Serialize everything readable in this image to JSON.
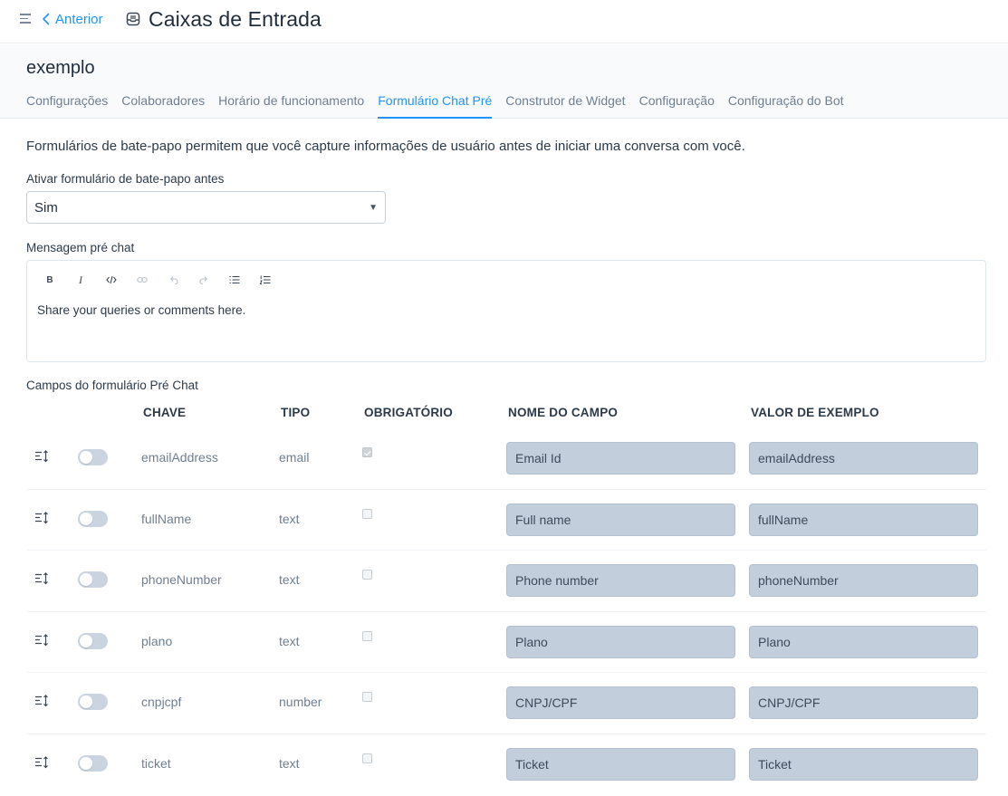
{
  "header": {
    "back_label": "Anterior",
    "title": "Caixas de Entrada"
  },
  "inbox": {
    "name": "exemplo",
    "tabs": [
      {
        "label": "Configurações",
        "active": false
      },
      {
        "label": "Colaboradores",
        "active": false
      },
      {
        "label": "Horário de funcionamento",
        "active": false
      },
      {
        "label": "Formulário Chat Pré",
        "active": true
      },
      {
        "label": "Construtor de Widget",
        "active": false
      },
      {
        "label": "Configuração",
        "active": false
      },
      {
        "label": "Configuração do Bot",
        "active": false
      }
    ]
  },
  "form": {
    "description": "Formulários de bate-papo permitem que você capture informações de usuário antes de iniciar uma conversa com você.",
    "enable_label": "Ativar formulário de bate-papo antes",
    "enable_value": "Sim",
    "message_label": "Mensagem pré chat",
    "message_text": "Share your queries or comments here.",
    "toolbar_icons": [
      "bold-icon",
      "italic-icon",
      "code-icon",
      "link-icon",
      "undo-icon",
      "redo-icon",
      "bullet-list-icon",
      "ordered-list-icon"
    ],
    "fields_label": "Campos do formulário Pré Chat"
  },
  "table": {
    "columns": {
      "key": "CHAVE",
      "type": "TIPO",
      "required": "OBRIGATÓRIO",
      "field_name": "NOME DO CAMPO",
      "sample_value": "VALOR DE EXEMPLO"
    },
    "rows": [
      {
        "key": "emailAddress",
        "type": "email",
        "required": true,
        "enabled": false,
        "field_name": "Email Id",
        "sample_value": "emailAddress"
      },
      {
        "key": "fullName",
        "type": "text",
        "required": false,
        "enabled": false,
        "field_name": "Full name",
        "sample_value": "fullName"
      },
      {
        "key": "phoneNumber",
        "type": "text",
        "required": false,
        "enabled": false,
        "field_name": "Phone number",
        "sample_value": "phoneNumber"
      },
      {
        "key": "plano",
        "type": "text",
        "required": false,
        "enabled": false,
        "field_name": "Plano",
        "sample_value": "Plano"
      },
      {
        "key": "cnpjcpf",
        "type": "number",
        "required": false,
        "enabled": false,
        "field_name": "CNPJ/CPF",
        "sample_value": "CNPJ/CPF"
      },
      {
        "key": "ticket",
        "type": "text",
        "required": false,
        "enabled": false,
        "field_name": "Ticket",
        "sample_value": "Ticket"
      }
    ]
  },
  "colors": {
    "accent": "#1f93ff",
    "input_fill": "#c3cedc",
    "toggle_off": "#c9d4e0"
  }
}
